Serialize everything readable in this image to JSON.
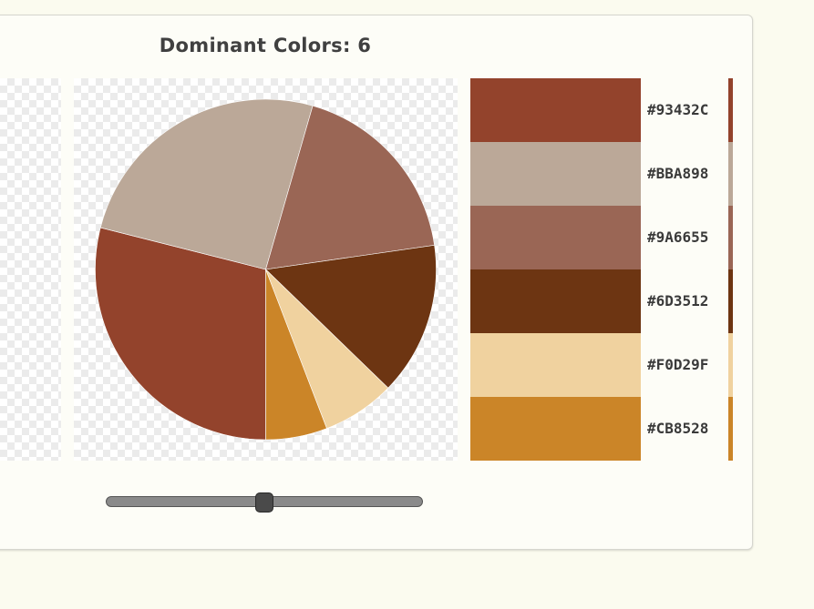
{
  "header": {
    "title": "Dominant Colors: 6"
  },
  "colors": [
    {
      "hex": "#93432C",
      "label": "#93432C",
      "share": 0.293
    },
    {
      "hex": "#BBA898",
      "label": "#BBA898",
      "share": 0.258
    },
    {
      "hex": "#9A6655",
      "label": "#9A6655",
      "share": 0.185
    },
    {
      "hex": "#6D3512",
      "label": "#6D3512",
      "share": 0.147
    },
    {
      "hex": "#F0D29F",
      "label": "#F0D29F",
      "share": 0.07
    },
    {
      "hex": "#CB8528",
      "label": "#CB8528",
      "share": 0.059
    }
  ],
  "slider": {
    "fraction": 0.5
  }
}
